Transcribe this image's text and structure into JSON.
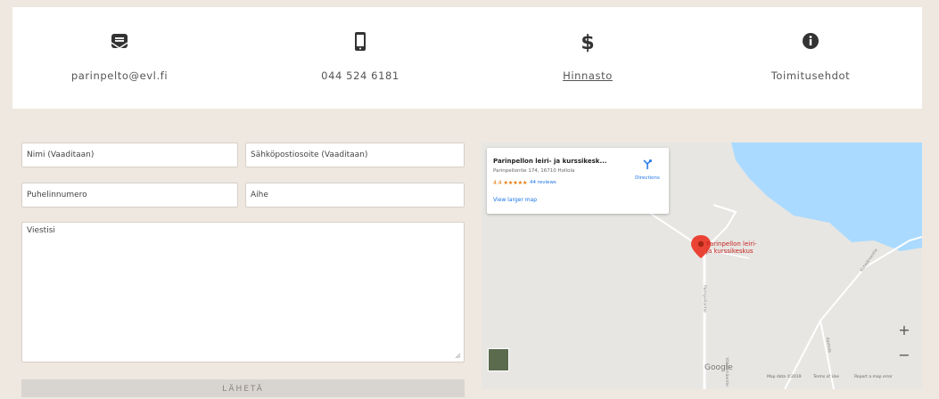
{
  "contacts": [
    {
      "label": "parinpelto@evl.fi",
      "icon": "envelope-icon"
    },
    {
      "label": "044 524 6181",
      "icon": "phone-icon"
    },
    {
      "label": "Hinnasto",
      "icon": "dollar-icon"
    },
    {
      "label": "Toimitusehdot",
      "icon": "info-icon"
    }
  ],
  "form": {
    "name_placeholder": "Nimi (Vaaditaan)",
    "email_placeholder": "Sähköpostiosoite (Vaaditaan)",
    "phone_placeholder": "Puhelinnumero",
    "subject_placeholder": "Aihe",
    "message_placeholder": "Viestisi",
    "send_label": "LÄHETÄ"
  },
  "map": {
    "place_title": "Parinpellon leiri- ja kurssikesk...",
    "address": "Parinpellontie 174, 16710 Hollola",
    "rating": "4.4 ★★★★★",
    "reviews": "44 reviews",
    "view_larger": "View larger map",
    "directions": "Directions",
    "pin_label_line1": "Parinpellon leiri-",
    "pin_label_line2": "ja kurssikeskus",
    "road_label_1": "Parinpellontie",
    "road_label_2": "Kutajärventie",
    "road_label_3": "Kantola",
    "road_label_4": "Vähänmäentie",
    "zoom_in": "+",
    "zoom_out": "−",
    "google_logo": "Google",
    "map_data": "Map data ©2019",
    "terms": "Terms of Use",
    "report": "Report a map error"
  },
  "colors": {
    "background": "#efe8e0",
    "water": "#aadaff",
    "pin": "#ea4335"
  }
}
